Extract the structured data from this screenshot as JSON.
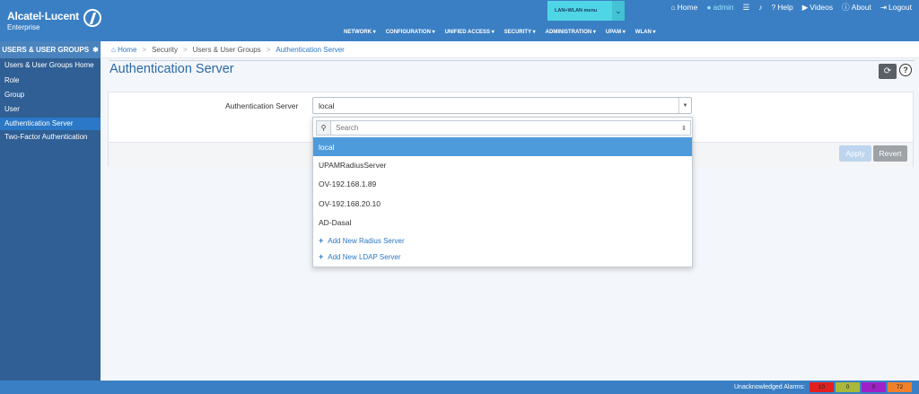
{
  "brand": {
    "name": "Alcatel·Lucent",
    "sub": "Enterprise"
  },
  "lan_wlan": {
    "label": "LAN+WLAN menu",
    "chevron": "chevron-down-icon"
  },
  "toplinks": [
    {
      "label": "Home",
      "icon": "home-icon"
    },
    {
      "label": "admin",
      "icon": "user-icon"
    },
    {
      "label": "",
      "icon": "list-icon"
    },
    {
      "label": "",
      "icon": "bell-icon"
    },
    {
      "label": "Help",
      "icon": "question-icon"
    },
    {
      "label": "Videos",
      "icon": "video-icon"
    },
    {
      "label": "About",
      "icon": "info-icon"
    },
    {
      "label": "Logout",
      "icon": "logout-icon"
    }
  ],
  "mainnav": [
    "NETWORK ▾",
    "CONFIGURATION ▾",
    "UNIFIED ACCESS ▾",
    "SECURITY ▾",
    "ADMINISTRATION ▾",
    "UPAM ▾",
    "WLAN ▾"
  ],
  "sidebar": {
    "title": "USERS & USER GROUPS",
    "items": [
      {
        "label": "Users & User Groups Home"
      },
      {
        "label": "Role"
      },
      {
        "label": "Group"
      },
      {
        "label": "User"
      },
      {
        "label": "Authentication Server"
      },
      {
        "label": "Two-Factor Authentication"
      }
    ]
  },
  "breadcrumb": {
    "home": "Home",
    "items": [
      "Security",
      "Users & User Groups",
      "Authentication Server"
    ]
  },
  "page_title": "Authentication Server",
  "form": {
    "label": "Authentication Server",
    "selected": "local",
    "search_placeholder": "Search",
    "options": [
      "local",
      "UPAMRadiusServer",
      "OV-192.168.1.89",
      "OV-192.168.20.10",
      "AD-Dasal"
    ],
    "add_actions": [
      "Add New Radius Server",
      "Add New LDAP Server"
    ],
    "apply_label": "Apply",
    "revert_label": "Revert"
  },
  "alarms": {
    "label": "Unacknowledged Alarms:",
    "items": [
      {
        "value": "10",
        "color": "#e32020"
      },
      {
        "value": "0",
        "color": "#a8b83a"
      },
      {
        "value": "0",
        "color": "#a020c8"
      },
      {
        "value": "72",
        "color": "#f0802a"
      }
    ]
  }
}
